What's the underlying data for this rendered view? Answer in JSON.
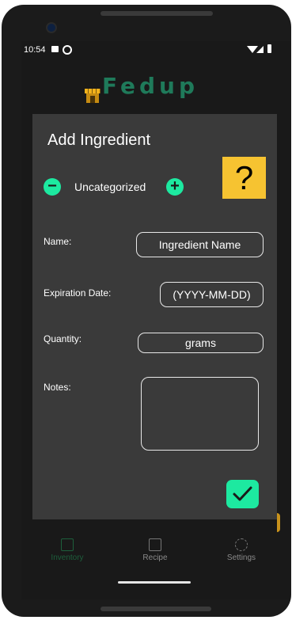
{
  "status_bar": {
    "time": "10:54"
  },
  "app": {
    "logo_text": "Fedup",
    "logo_icon": "store-icon"
  },
  "dialog": {
    "title": "Add Ingredient",
    "category": "Uncategorized",
    "help_label": "?",
    "fields": {
      "name_label": "Name:",
      "name_placeholder": "Ingredient Name",
      "expiration_label": "Expiration Date:",
      "expiration_placeholder": "(YYYY-MM-DD)",
      "quantity_label": "Quantity:",
      "quantity_placeholder": "grams",
      "notes_label": "Notes:"
    },
    "accent_color": "#1de9a0",
    "help_color": "#f6c331"
  },
  "bottom_nav": {
    "items": [
      {
        "label": "Inventory",
        "icon": "inventory-icon",
        "active": true
      },
      {
        "label": "Recipe",
        "icon": "recipe-icon",
        "active": false
      },
      {
        "label": "Settings",
        "icon": "settings-icon",
        "active": false
      }
    ]
  }
}
